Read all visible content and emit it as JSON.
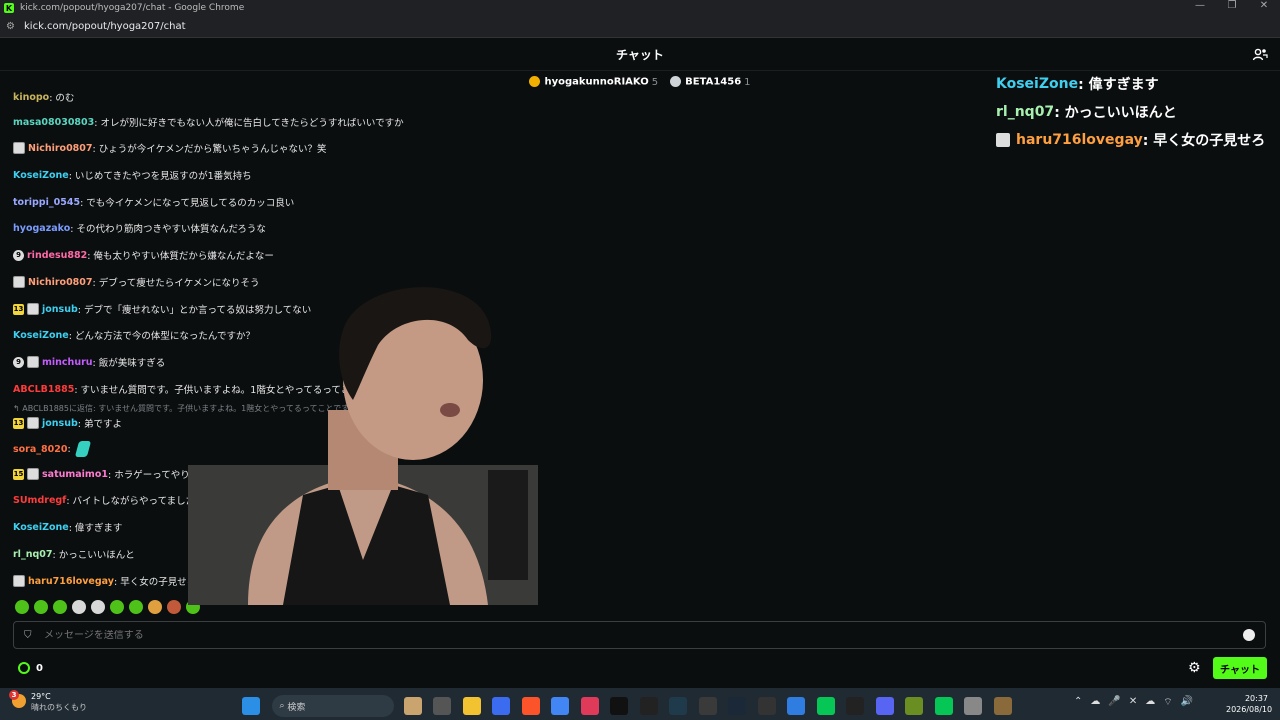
{
  "window": {
    "title": "kick.com/popout/hyoga207/chat - Google Chrome",
    "url": "kick.com/popout/hyoga207/chat"
  },
  "header": {
    "title": "チャット"
  },
  "pinned": [
    {
      "name": "hyogakunnoRIAKO",
      "count": "5",
      "color": "#f2b100"
    },
    {
      "name": "BETA1456",
      "count": "1",
      "color": "#cfd4d8"
    }
  ],
  "messages": [
    {
      "user": "kinopo",
      "text": ": のむ",
      "color": "#c8b45c",
      "badges": []
    },
    {
      "user": "masa08030803",
      "text": ": オレが別に好きでもない人が俺に告白してきたらどうすればいいですか",
      "color": "#5ad6c0",
      "badges": []
    },
    {
      "user": "Nichiro0807",
      "text": ": ひょうが今イケメンだから驚いちゃうんじゃない？笑",
      "color": "#ff9f7a",
      "badges": [
        "avatar"
      ]
    },
    {
      "user": "KoseiZone",
      "text": ": いじめてきたやつを見返すのが1番気持ち",
      "color": "#3fd0f0",
      "badges": []
    },
    {
      "user": "torippi_0545",
      "text": ": でも今イケメンになって見返してるのカッコ良い",
      "color": "#9aa8ff",
      "badges": []
    },
    {
      "user": "hyogazako",
      "text": ": その代わり筋肉つきやすい体質なんだろうな",
      "color": "#7b9cff",
      "badges": []
    },
    {
      "user": "rindesu882",
      "text": ": 俺も太りやすい体質だから嫌なんだよなー",
      "color": "#ff6aa8",
      "badges": [
        "circle"
      ]
    },
    {
      "user": "Nichiro0807",
      "text": ": デブって痩せたらイケメンになりそう",
      "color": "#ff9f7a",
      "badges": [
        "avatar"
      ]
    },
    {
      "user": "jonsub",
      "text": ": デブで「痩せれない」とか言ってる奴は努力してない",
      "color": "#3fd0f0",
      "badges": [
        "sub13",
        "avatar"
      ]
    },
    {
      "user": "KoseiZone",
      "text": ": どんな方法で今の体型になったんですか？",
      "color": "#3fd0f0",
      "badges": []
    },
    {
      "user": "minchuru",
      "text": ": 飯が美味すぎる",
      "color": "#c45cff",
      "badges": [
        "circle",
        "avatar"
      ]
    },
    {
      "user": "ABCLB1885",
      "text": ": すいません質問です。子供いますよね。1階女とやってるってこと",
      "color": "#ff3b3b",
      "badges": []
    },
    {
      "user": "jonsub",
      "text": ": 弟ですよ",
      "color": "#3fd0f0",
      "badges": [
        "sub13",
        "avatar"
      ]
    },
    {
      "user": "sora_8020",
      "text": ":",
      "color": "#ff7043",
      "badges": []
    },
    {
      "user": "satumaimo1",
      "text": ": ホラゲーってやりましたか？",
      "color": "#ff7bd0",
      "badges": [
        "sub15",
        "avatar"
      ]
    },
    {
      "user": "SUmdregf",
      "text": ": バイトしながらやってました",
      "color": "#ff3b3b",
      "badges": []
    },
    {
      "user": "KoseiZone",
      "text": ": 偉すぎます",
      "color": "#3fd0f0",
      "badges": []
    },
    {
      "user": "rl_nq07",
      "text": ": かっこいいほんと",
      "color": "#a8f0b0",
      "badges": []
    },
    {
      "user": "haru716lovegay",
      "text": ": 早く女の子見せろ",
      "color": "#ffa040",
      "badges": [
        "avatar"
      ]
    }
  ],
  "reply": "↰ ABCLB1885に返信: すいません質問です。子供いますよね。1階女とやってるってことです",
  "badge_labels": {
    "sub13": "13",
    "sub15": "15",
    "circle": "9"
  },
  "overlay": [
    {
      "user": "KoseiZone",
      "text": " : 偉すぎます",
      "color": "#3fd0f0",
      "avatar": false
    },
    {
      "user": "rl_nq07",
      "text": " : かっこいいほんと",
      "color": "#a8f0b0",
      "avatar": false
    },
    {
      "user": "haru716lovegay",
      "text": " : 早く女の子見せろ",
      "color": "#ffa040",
      "avatar": true
    }
  ],
  "input": {
    "placeholder": "メッセージを送信する"
  },
  "footer": {
    "points": "0",
    "send_label": "チャット"
  },
  "taskbar": {
    "temp": "29°C",
    "condition": "晴れのちくもり",
    "weather_badge": "3",
    "search_placeholder": "検索",
    "time": "20:37",
    "date": "2026/08/10"
  }
}
